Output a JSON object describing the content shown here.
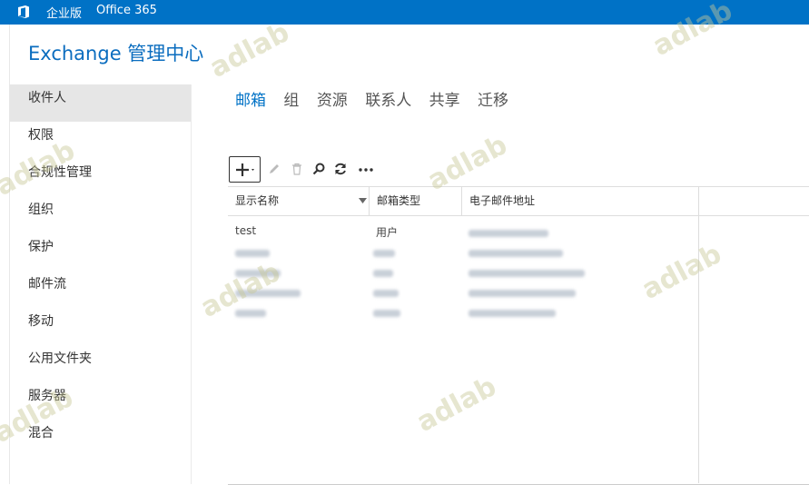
{
  "topbar": {
    "edition": "企业版",
    "product": "Office 365"
  },
  "app_title": "Exchange 管理中心",
  "nav": [
    {
      "label": "收件人",
      "selected": true
    },
    {
      "label": "权限"
    },
    {
      "label": "合规性管理"
    },
    {
      "label": "组织"
    },
    {
      "label": "保护"
    },
    {
      "label": "邮件流"
    },
    {
      "label": "移动"
    },
    {
      "label": "公用文件夹"
    },
    {
      "label": "服务器"
    },
    {
      "label": "混合"
    }
  ],
  "tabs": [
    {
      "label": "邮箱",
      "selected": true
    },
    {
      "label": "组"
    },
    {
      "label": "资源"
    },
    {
      "label": "联系人"
    },
    {
      "label": "共享"
    },
    {
      "label": "迁移"
    }
  ],
  "toolbar": {
    "icons": [
      "add-icon",
      "edit-icon",
      "delete-icon",
      "search-icon",
      "refresh-icon",
      "more-icon"
    ]
  },
  "table": {
    "columns": [
      "显示名称",
      "邮箱类型",
      "电子邮件地址"
    ],
    "rows": [
      {
        "name": "test",
        "type": "用户",
        "email": ""
      },
      {
        "name": "",
        "type": "",
        "email": ""
      },
      {
        "name": "",
        "type": "",
        "email": ""
      },
      {
        "name": "",
        "type": "",
        "email": ""
      },
      {
        "name": "",
        "type": "",
        "email": ""
      }
    ]
  },
  "watermark": "adlab",
  "colors": {
    "accent": "#0072c6",
    "title": "#0b6dbf",
    "nav_selected": "#e6e6e6"
  }
}
